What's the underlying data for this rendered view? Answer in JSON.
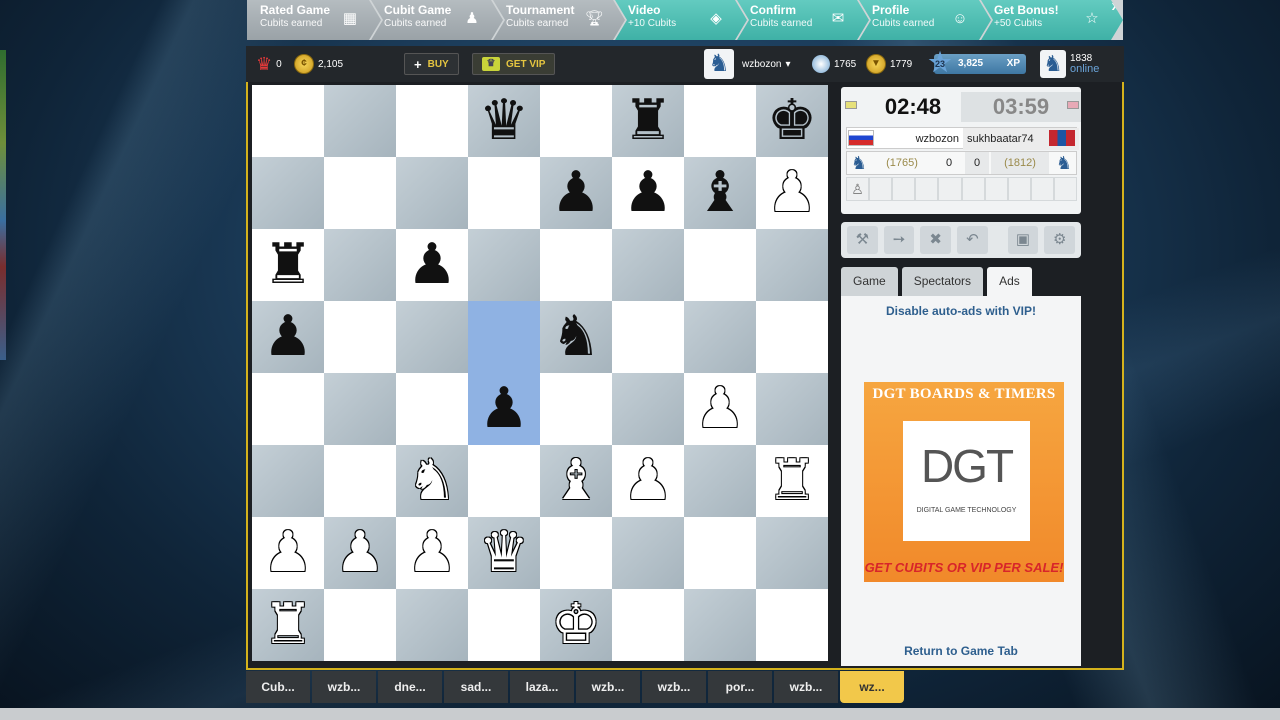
{
  "nav": {
    "items": [
      {
        "title": "Rated Game",
        "sub": "Cubits earned",
        "icon": "board-icon"
      },
      {
        "title": "Cubit Game",
        "sub": "Cubits earned",
        "icon": "pawn-board-icon"
      },
      {
        "title": "Tournament",
        "sub": "Cubits earned",
        "icon": "trophy-icon"
      },
      {
        "title": "Video",
        "sub": "+10 Cubits",
        "icon": "video-icon"
      },
      {
        "title": "Confirm",
        "sub": "Cubits earned",
        "icon": "mail-icon"
      },
      {
        "title": "Profile",
        "sub": "Cubits earned",
        "icon": "person-icon"
      },
      {
        "title": "Get Bonus!",
        "sub": "+50 Cubits",
        "icon": "star-icon"
      }
    ],
    "close": "x"
  },
  "status": {
    "crowns": "0",
    "cubits": "2,105",
    "buy_label": "BUY",
    "vip_label": "GET VIP",
    "username": "wzbozon",
    "rating1": "1765",
    "rating2": "1779",
    "level": "23",
    "xp": "3,825",
    "xp_label": "XP",
    "online_count": "1838",
    "online_label": "online"
  },
  "board": {
    "squares": [
      [
        "",
        "",
        "",
        "bq",
        "",
        "br",
        "",
        "bk"
      ],
      [
        "",
        "",
        "",
        "",
        "bp",
        "bp",
        "bb",
        "wp"
      ],
      [
        "br",
        "",
        "bp",
        "",
        "",
        "",
        "",
        ""
      ],
      [
        "bp",
        "",
        "",
        "",
        "bn",
        "",
        "",
        ""
      ],
      [
        "",
        "",
        "",
        "bp",
        "",
        "",
        "wp",
        ""
      ],
      [
        "",
        "",
        "wn",
        "",
        "wb",
        "wp",
        "",
        "wr"
      ],
      [
        "wp",
        "wp",
        "wp",
        "wq",
        "",
        "",
        "",
        ""
      ],
      [
        "wr",
        "",
        "",
        "",
        "wk",
        "",
        "",
        ""
      ]
    ],
    "highlight": [
      "d5",
      "d4"
    ]
  },
  "clock": {
    "my_time": "02:48",
    "opp_time": "03:59",
    "my_name": "wzbozon",
    "opp_name": "sukhbaatar74",
    "my_rating": "(1765)",
    "opp_rating": "(1812)",
    "my_score": "0",
    "opp_score": "0"
  },
  "panel_tabs": [
    "Game",
    "Spectators",
    "Ads"
  ],
  "ads": {
    "disable_text": "Disable auto-ads with VIP!",
    "banner_top": "DGT BOARDS & TIMERS",
    "logo": "DGT",
    "logo_sub": "DIGITAL GAME TECHNOLOGY",
    "banner_bottom": "GET CUBITS OR VIP PER SALE!",
    "return_text": "Return to Game Tab"
  },
  "bottom_tabs": [
    "Cub...",
    "wzb...",
    "dne...",
    "sad...",
    "laza...",
    "wzb...",
    "wzb...",
    "por...",
    "wzb...",
    "wz..."
  ],
  "colors": {
    "accent": "#d4b21c",
    "nav_teal": "#4fbdb2",
    "highlight": "#8fb2e3"
  }
}
